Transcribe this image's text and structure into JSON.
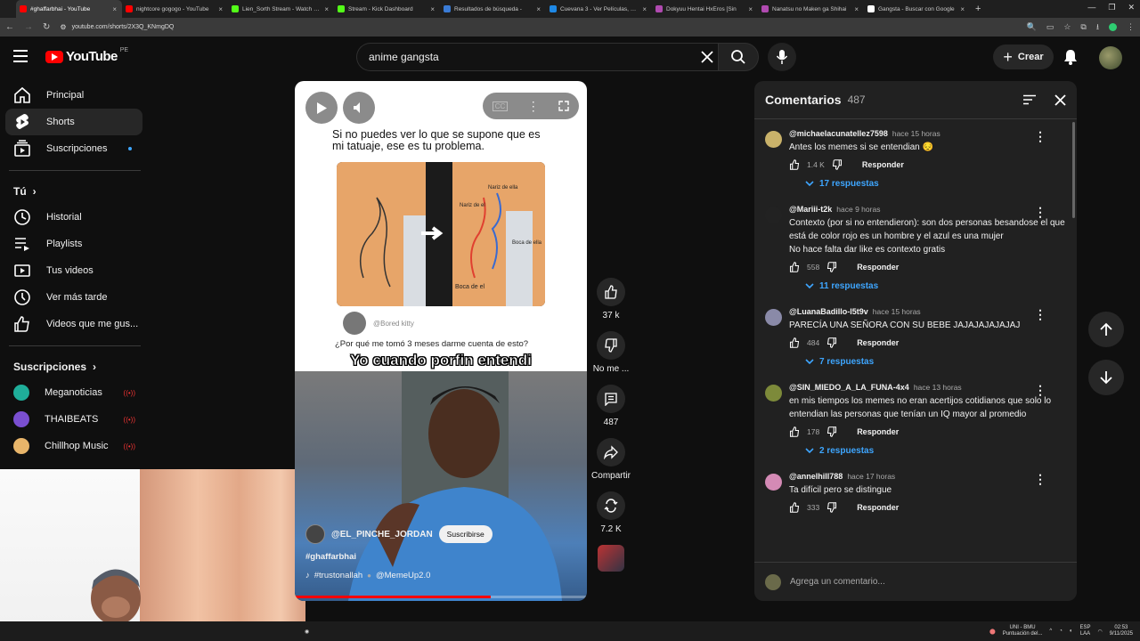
{
  "browser": {
    "tabs": [
      {
        "label": "#ghaffarbhai - YouTube",
        "active": true,
        "color": "#ff0000"
      },
      {
        "label": "nightcore gogogo - YouTube",
        "active": false,
        "color": "#ff0000"
      },
      {
        "label": "Lien_Sorth Stream - Watch Live",
        "active": false,
        "color": "#53fc18"
      },
      {
        "label": "Stream - Kick Dashboard",
        "active": false,
        "color": "#53fc18"
      },
      {
        "label": "Resultados de búsqueda - ",
        "active": false,
        "color": "#3a7bd5"
      },
      {
        "label": "Cuevana 3 - Ver Películas, ver se",
        "active": false,
        "color": "#1e88e5"
      },
      {
        "label": "Dokyuu Hentai HxEros [Sin",
        "active": false,
        "color": "#b04ab0"
      },
      {
        "label": "Nanatsu no Maken ga Shihai",
        "active": false,
        "color": "#b04ab0"
      },
      {
        "label": "Gangsta - Buscar con Google",
        "active": false,
        "color": "#ffffff"
      }
    ],
    "url": "youtube.com/shorts/2X3Q_KNmgDQ"
  },
  "header": {
    "logo_text": "YouTube",
    "country": "PE",
    "search_value": "anime gangsta",
    "create_label": "Crear"
  },
  "sidebar": {
    "main": [
      {
        "label": "Principal",
        "icon": "home-icon"
      },
      {
        "label": "Shorts",
        "icon": "shorts-icon",
        "selected": true
      },
      {
        "label": "Suscripciones",
        "icon": "subscriptions-icon"
      }
    ],
    "you_title": "Tú",
    "you_items": [
      {
        "label": "Historial",
        "icon": "history-icon"
      },
      {
        "label": "Playlists",
        "icon": "playlists-icon"
      },
      {
        "label": "Tus videos",
        "icon": "your-videos-icon"
      },
      {
        "label": "Ver más tarde",
        "icon": "watch-later-icon"
      },
      {
        "label": "Videos que me gus...",
        "icon": "liked-icon"
      }
    ],
    "subs_title": "Suscripciones",
    "subs": [
      {
        "label": "Meganoticias",
        "color": "#1fae9a"
      },
      {
        "label": "THAIBEATS",
        "color": "#7a4fd1"
      },
      {
        "label": "Chillhop Music",
        "color": "#e8b56a"
      }
    ]
  },
  "short": {
    "meme_text": "Si no puedes ver lo que se supone que es mi tatuaje, ese es tu problema.",
    "tattoo_label_1": "Nariz de ella",
    "tattoo_label_2": "Nariz de el",
    "tattoo_label_3": "Boca de ella",
    "tattoo_label_4": "Boca de el",
    "bored_handle": "@Bored kitty",
    "meme_question": "¿Por qué me tomó 3 meses darme cuenta de esto?",
    "caption": "Yo cuando porfin entendi",
    "channel": "@EL_PINCHE_JORDAN",
    "subscribe": "Suscribirse",
    "hashtag": "#ghaffarbhai",
    "music": "#trustonallah",
    "music_credit": "@MemeUp2.0",
    "progress": 0.67
  },
  "actions": {
    "likes": "37 k",
    "dislike": "No me ...",
    "comments": "487",
    "share": "Compartir",
    "remix": "7.2 K"
  },
  "comments": {
    "title": "Comentarios",
    "count": "487",
    "input_placeholder": "Agrega un comentario...",
    "reply_label": "Responder",
    "items": [
      {
        "author": "@michaelacunatellez7598",
        "time": "hace 15 horas",
        "text": "Antes los memes si se entendian 😔",
        "likes": "1.4 K",
        "replies": "17 respuestas",
        "color": "#c9b26a"
      },
      {
        "author": "@Mariii-t2k",
        "time": "hace 9 horas",
        "text": "Contexto (por si no entendieron): son dos personas besandose el que está de color rojo es un hombre y el azul es una mujer\nNo hace falta dar like es contexto gratis",
        "likes": "558",
        "replies": "11 respuestas",
        "color": "#222222"
      },
      {
        "author": "@LuanaBadillo-l5t9v",
        "time": "hace 15 horas",
        "text": "PARECÍA UNA SEÑORA CON SU BEBE JAJAJAJAJAJAJ",
        "likes": "484",
        "replies": "7 respuestas",
        "color": "#8a8aa8"
      },
      {
        "author": "@SIN_MIEDO_A_LA_FUNA-4x4",
        "time": "hace 13 horas",
        "text": "en mis tiempos los memes no eran acertijos cotidianos que solo lo entendian las personas que tenían un IQ mayor al promedio",
        "likes": "178",
        "replies": "2 respuestas",
        "color": "#7d8a3a"
      },
      {
        "author": "@annelhill788",
        "time": "hace 17 horas",
        "text": "Ta difícil pero se distingue",
        "likes": "333",
        "replies": "",
        "color": "#d48ab5"
      }
    ]
  },
  "taskbar": {
    "weather": "UNI - BMU",
    "weather_sub": "Puntuación del...",
    "lang": "ESP",
    "lang_sub": "LAA",
    "time": "02:53",
    "date": "9/11/2025"
  }
}
